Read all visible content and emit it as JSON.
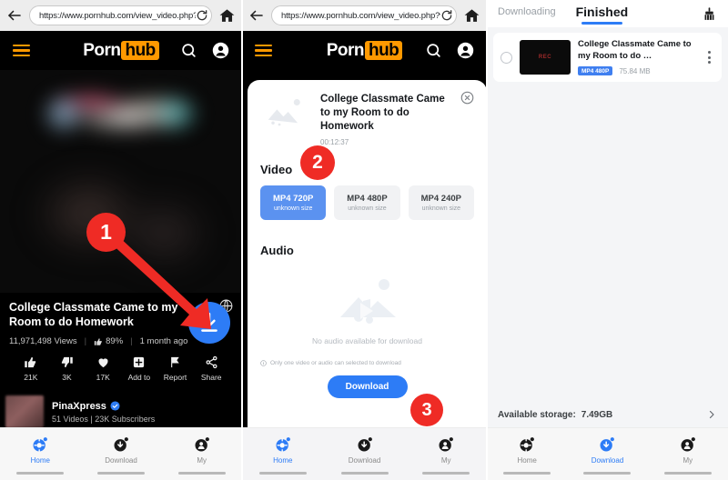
{
  "panel1": {
    "browser": {
      "url": "https://www.pornhub.com/view_video.php?vi",
      "back_icon": "back-arrow-icon",
      "reload_icon": "reload-icon",
      "home_icon": "home-icon"
    },
    "site_header": {
      "logo_first": "Porn",
      "logo_second": "hub",
      "menu_icon": "hamburger-menu-icon",
      "search_icon": "search-icon",
      "account_icon": "account-icon"
    },
    "video": {
      "title": "College Classmate Came to my Room to do Homework",
      "views": "11,971,498 Views",
      "rating": "89%",
      "age": "1 month ago"
    },
    "actions": [
      {
        "label": "21K",
        "icon": "thumbs-up-icon"
      },
      {
        "label": "3K",
        "icon": "thumbs-down-icon"
      },
      {
        "label": "17K",
        "icon": "heart-icon"
      },
      {
        "label": "Add to",
        "icon": "add-to-playlist-icon"
      },
      {
        "label": "Report",
        "icon": "flag-icon"
      },
      {
        "label": "Share",
        "icon": "share-icon"
      }
    ],
    "download_fab_icon": "download-circle-button",
    "globe_icon": "globe-icon",
    "channel": {
      "name": "PinaXpress",
      "verified_icon": "verified-badge-icon",
      "stats": "51 Videos | 23K Subscribers"
    },
    "bottom_nav": [
      {
        "label": "Home",
        "icon": "home-nav-icon",
        "active": true
      },
      {
        "label": "Download",
        "icon": "download-nav-icon",
        "active": false
      },
      {
        "label": "My",
        "icon": "my-nav-icon",
        "active": false
      }
    ]
  },
  "panel2": {
    "browser": {
      "url": "https://www.pornhub.com/view_video.php?vi"
    },
    "site_header": {
      "logo_first": "Porn",
      "logo_second": "hub"
    },
    "sheet": {
      "title": "College Classmate Came to my Room to do Homework",
      "duration": "00:12:37",
      "close_icon": "close-icon",
      "thumbnail_icon": "broken-image-icon",
      "video_section_label": "Video",
      "qualities": [
        {
          "name": "MP4 720P",
          "size": "unknown size",
          "selected": true
        },
        {
          "name": "MP4 480P",
          "size": "unknown size",
          "selected": false
        },
        {
          "name": "MP4 240P",
          "size": "unknown size",
          "selected": false
        }
      ],
      "audio_section_label": "Audio",
      "audio_empty_text": "No audio available for download",
      "audio_empty_icon": "no-audio-icon",
      "hint": "Only one video or audio can selected to download",
      "hint_icon": "info-icon",
      "download_button": "Download"
    },
    "bottom_nav": [
      {
        "label": "Home",
        "icon": "home-nav-icon",
        "active": true
      },
      {
        "label": "Download",
        "icon": "download-nav-icon",
        "active": false
      },
      {
        "label": "My",
        "icon": "my-nav-icon",
        "active": false
      }
    ]
  },
  "panel3": {
    "tabs": [
      {
        "label": "Downloading",
        "active": false
      },
      {
        "label": "Finished",
        "active": true
      }
    ],
    "clean_icon": "broom-clean-icon",
    "items": [
      {
        "title": "College Classmate Came to my Room to do …",
        "badge": "MP4 480P",
        "size": "75.84 MB",
        "thumb_label": "REC",
        "select_icon": "radio-unchecked-icon",
        "menu_icon": "more-vertical-icon"
      }
    ],
    "storage": {
      "label": "Available storage:",
      "value": "7.49GB",
      "chevron_icon": "chevron-right-icon"
    },
    "bottom_nav": [
      {
        "label": "Home",
        "icon": "home-nav-icon",
        "active": false
      },
      {
        "label": "Download",
        "icon": "download-nav-icon",
        "active": true
      },
      {
        "label": "My",
        "icon": "my-nav-icon",
        "active": false
      }
    ]
  },
  "callouts": [
    {
      "number": "1"
    },
    {
      "number": "2"
    },
    {
      "number": "3"
    }
  ]
}
